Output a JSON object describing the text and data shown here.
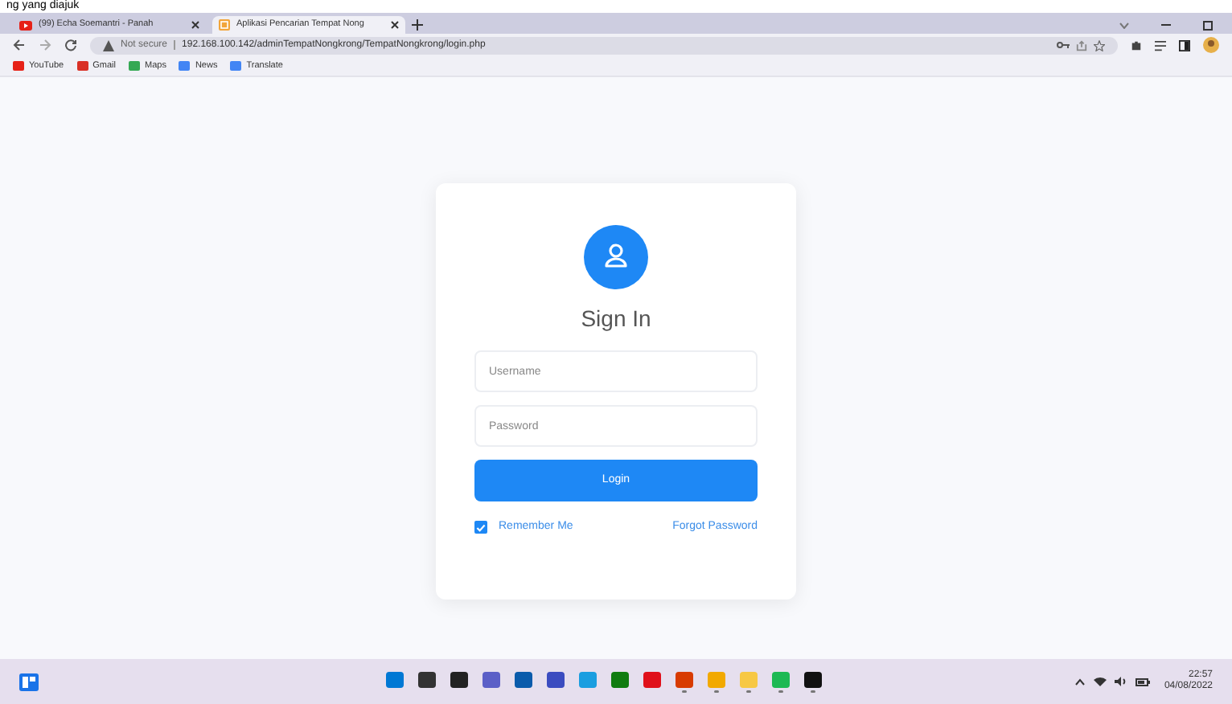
{
  "top_caption": "ng yang diajuk",
  "tabs": [
    {
      "title": "(99) Echa Soemantri - Panah",
      "selected": false,
      "kind": "video"
    },
    {
      "title": "Aplikasi Pencarian Tempat Nong",
      "selected": true,
      "kind": "app"
    }
  ],
  "address_bar": {
    "security": "Not secure",
    "url": "192.168.100.142/adminTempatNongkrong/TempatNongkrong/login.php"
  },
  "bookmarks": [
    {
      "label": "YouTube",
      "color": "#e62117"
    },
    {
      "label": "Gmail",
      "color": "#d93025"
    },
    {
      "label": "Maps",
      "color": "#34a853"
    },
    {
      "label": "News",
      "color": "#4285f4"
    },
    {
      "label": "Translate",
      "color": "#4285f4"
    }
  ],
  "login": {
    "title": "Sign In",
    "username": {
      "placeholder": "Username"
    },
    "password": {
      "placeholder": "Password"
    },
    "button": "Login",
    "remember": {
      "label": "Remember Me",
      "checked": true
    },
    "forgot": "Forgot Password"
  },
  "taskbar": {
    "apps": [
      {
        "color": "#0078d4",
        "running": false
      },
      {
        "color": "#333333",
        "running": false
      },
      {
        "color": "#222222",
        "running": false
      },
      {
        "color": "#5b5fc7",
        "running": false
      },
      {
        "color": "#0a5bab",
        "running": false
      },
      {
        "color": "#3b4cc0",
        "running": false
      },
      {
        "color": "#1a9ee0",
        "running": false
      },
      {
        "color": "#107c10",
        "running": false
      },
      {
        "color": "#e0101a",
        "running": false
      },
      {
        "color": "#d83b01",
        "running": true
      },
      {
        "color": "#f2a900",
        "running": true
      },
      {
        "color": "#f7c844",
        "running": true
      },
      {
        "color": "#1db954",
        "running": true
      },
      {
        "color": "#111111",
        "running": true
      }
    ],
    "time": "22:57",
    "date": "04/08/2022"
  }
}
